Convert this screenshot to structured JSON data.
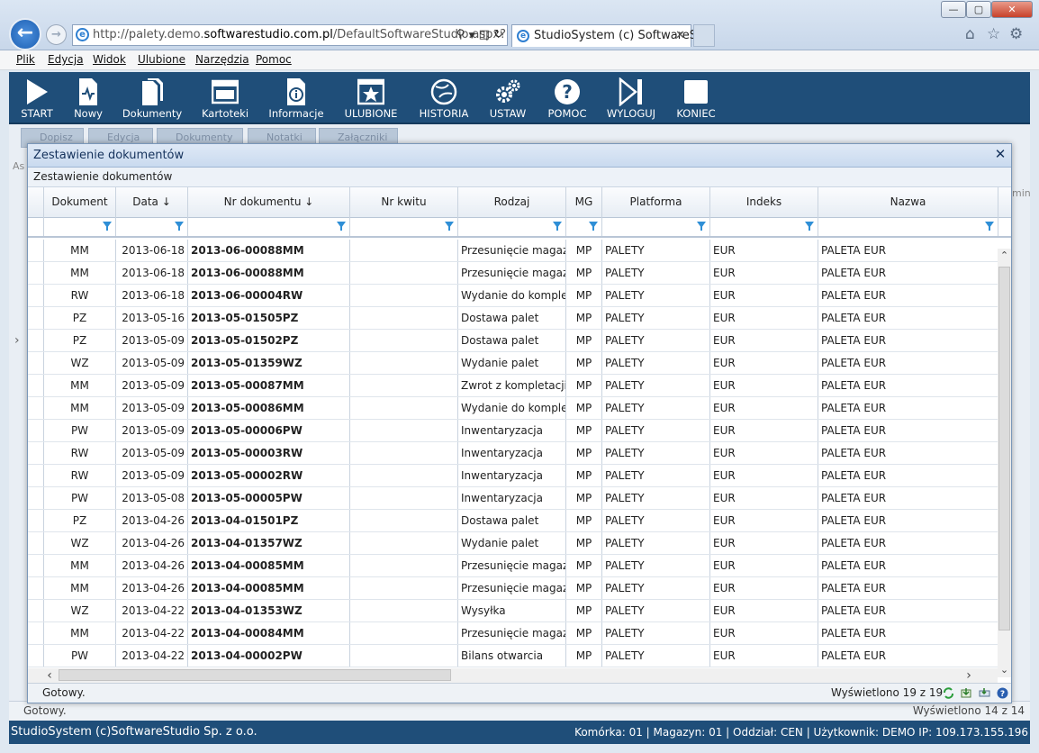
{
  "browser": {
    "url_prefix": "http://palety.demo.",
    "url_bold": "softwarestudio.com.pl",
    "url_suffix": "/DefaultSoftwareStudio.aspx?rol",
    "tab_title": "StudioSystem (c) SoftwareS...",
    "window_buttons": [
      "—",
      "▢",
      "✕"
    ]
  },
  "menu": [
    "Plik",
    "Edycja",
    "Widok",
    "Ulubione",
    "Narzędzia",
    "Pomoc"
  ],
  "toolbar": [
    {
      "label": "START",
      "icon": "play-icon"
    },
    {
      "label": "Nowy",
      "icon": "new-document-icon"
    },
    {
      "label": "Dokumenty",
      "icon": "documents-icon"
    },
    {
      "label": "Kartoteki",
      "icon": "window-icon"
    },
    {
      "label": "Informacje",
      "icon": "info-icon"
    },
    {
      "label": "ULUBIONE",
      "icon": "star-icon"
    },
    {
      "label": "HISTORIA",
      "icon": "history-icon"
    },
    {
      "label": "USTAW",
      "icon": "gears-icon"
    },
    {
      "label": "POMOC",
      "icon": "help-icon"
    },
    {
      "label": "WYLOGUJ",
      "icon": "logout-icon"
    },
    {
      "label": "KONIEC",
      "icon": "stop-icon"
    }
  ],
  "background": {
    "buttons": [
      "Dopisz",
      "Edycja",
      "Dokumenty",
      "Notatki",
      "Załączniki"
    ],
    "left_label": "As",
    "right_label": "min",
    "status_left": "Gotowy.",
    "status_right": "Wyświetlono 14 z 14"
  },
  "dialog": {
    "title": "Zestawienie dokumentów",
    "subtitle": "Zestawienie dokumentów",
    "columns": [
      "Dokument",
      "Data ↓",
      "Nr dokumentu ↓",
      "Nr kwitu",
      "Rodzaj",
      "MG",
      "Platforma",
      "Indeks",
      "Nazwa"
    ],
    "rows": [
      [
        "MM",
        "2013-06-18",
        "2013-06-00088MM",
        "",
        "Przesunięcie magazy",
        "MP",
        "PALETY",
        "EUR",
        "PALETA EUR"
      ],
      [
        "MM",
        "2013-06-18",
        "2013-06-00088MM",
        "",
        "Przesunięcie magazy",
        "MP",
        "PALETY",
        "EUR",
        "PALETA EUR"
      ],
      [
        "RW",
        "2013-06-18",
        "2013-06-00004RW",
        "",
        "Wydanie do komplet",
        "MP",
        "PALETY",
        "EUR",
        "PALETA EUR"
      ],
      [
        "PZ",
        "2013-05-16",
        "2013-05-01505PZ",
        "",
        "Dostawa palet",
        "MP",
        "PALETY",
        "EUR",
        "PALETA EUR"
      ],
      [
        "PZ",
        "2013-05-09",
        "2013-05-01502PZ",
        "",
        "Dostawa palet",
        "MP",
        "PALETY",
        "EUR",
        "PALETA EUR"
      ],
      [
        "WZ",
        "2013-05-09",
        "2013-05-01359WZ",
        "",
        "Wydanie palet",
        "MP",
        "PALETY",
        "EUR",
        "PALETA EUR"
      ],
      [
        "MM",
        "2013-05-09",
        "2013-05-00087MM",
        "",
        "Zwrot z kompletacji",
        "MP",
        "PALETY",
        "EUR",
        "PALETA EUR"
      ],
      [
        "MM",
        "2013-05-09",
        "2013-05-00086MM",
        "",
        "Wydanie do komplet",
        "MP",
        "PALETY",
        "EUR",
        "PALETA EUR"
      ],
      [
        "PW",
        "2013-05-09",
        "2013-05-00006PW",
        "",
        "Inwentaryzacja",
        "MP",
        "PALETY",
        "EUR",
        "PALETA EUR"
      ],
      [
        "RW",
        "2013-05-09",
        "2013-05-00003RW",
        "",
        "Inwentaryzacja",
        "MP",
        "PALETY",
        "EUR",
        "PALETA EUR"
      ],
      [
        "RW",
        "2013-05-09",
        "2013-05-00002RW",
        "",
        "Inwentaryzacja",
        "MP",
        "PALETY",
        "EUR",
        "PALETA EUR"
      ],
      [
        "PW",
        "2013-05-08",
        "2013-05-00005PW",
        "",
        "Inwentaryzacja",
        "MP",
        "PALETY",
        "EUR",
        "PALETA EUR"
      ],
      [
        "PZ",
        "2013-04-26",
        "2013-04-01501PZ",
        "",
        "Dostawa palet",
        "MP",
        "PALETY",
        "EUR",
        "PALETA EUR"
      ],
      [
        "WZ",
        "2013-04-26",
        "2013-04-01357WZ",
        "",
        "Wydanie palet",
        "MP",
        "PALETY",
        "EUR",
        "PALETA EUR"
      ],
      [
        "MM",
        "2013-04-26",
        "2013-04-00085MM",
        "",
        "Przesunięcie magazy",
        "MP",
        "PALETY",
        "EUR",
        "PALETA EUR"
      ],
      [
        "MM",
        "2013-04-26",
        "2013-04-00085MM",
        "",
        "Przesunięcie magazy",
        "MP",
        "PALETY",
        "EUR",
        "PALETA EUR"
      ],
      [
        "WZ",
        "2013-04-22",
        "2013-04-01353WZ",
        "",
        "Wysyłka",
        "MP",
        "PALETY",
        "EUR",
        "PALETA EUR"
      ],
      [
        "MM",
        "2013-04-22",
        "2013-04-00084MM",
        "",
        "Przesunięcie magazy",
        "MP",
        "PALETY",
        "EUR",
        "PALETA EUR"
      ],
      [
        "PW",
        "2013-04-22",
        "2013-04-00002PW",
        "",
        "Bilans otwarcia",
        "MP",
        "PALETY",
        "EUR",
        "PALETA EUR"
      ]
    ],
    "status_left": "Gotowy.",
    "status_right": "Wyświetlono 19 z 19"
  },
  "app_status": {
    "left": "StudioSystem (c)SoftwareStudio Sp. z o.o.",
    "right": "Komórka: 01 | Magazyn: 01 | Oddział: CEN | Użytkownik: DEMO IP: 109.173.155.196"
  }
}
